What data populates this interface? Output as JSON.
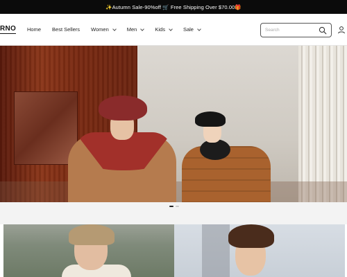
{
  "announcement": {
    "text": "✨Autumn Sale-90%off 🛒 Free Shipping Over $70.00🎁"
  },
  "header": {
    "logo": "RNO",
    "nav": [
      {
        "label": "Home",
        "has_dropdown": false
      },
      {
        "label": "Best Sellers",
        "has_dropdown": false
      },
      {
        "label": "Women",
        "has_dropdown": true
      },
      {
        "label": "Men",
        "has_dropdown": true
      },
      {
        "label": "Kids",
        "has_dropdown": true
      },
      {
        "label": "Sale",
        "has_dropdown": true
      }
    ],
    "search": {
      "placeholder": "Search",
      "value": ""
    },
    "icons": {
      "search": "search-icon",
      "account": "user-icon",
      "dropdown": "chevron-down-icon"
    }
  },
  "hero": {
    "slide_count": 2,
    "active_slide": 1
  },
  "colors": {
    "announcement_bg": "#0b0b0b",
    "announcement_text": "#ffffff",
    "text": "#222222",
    "border": "#555555"
  }
}
